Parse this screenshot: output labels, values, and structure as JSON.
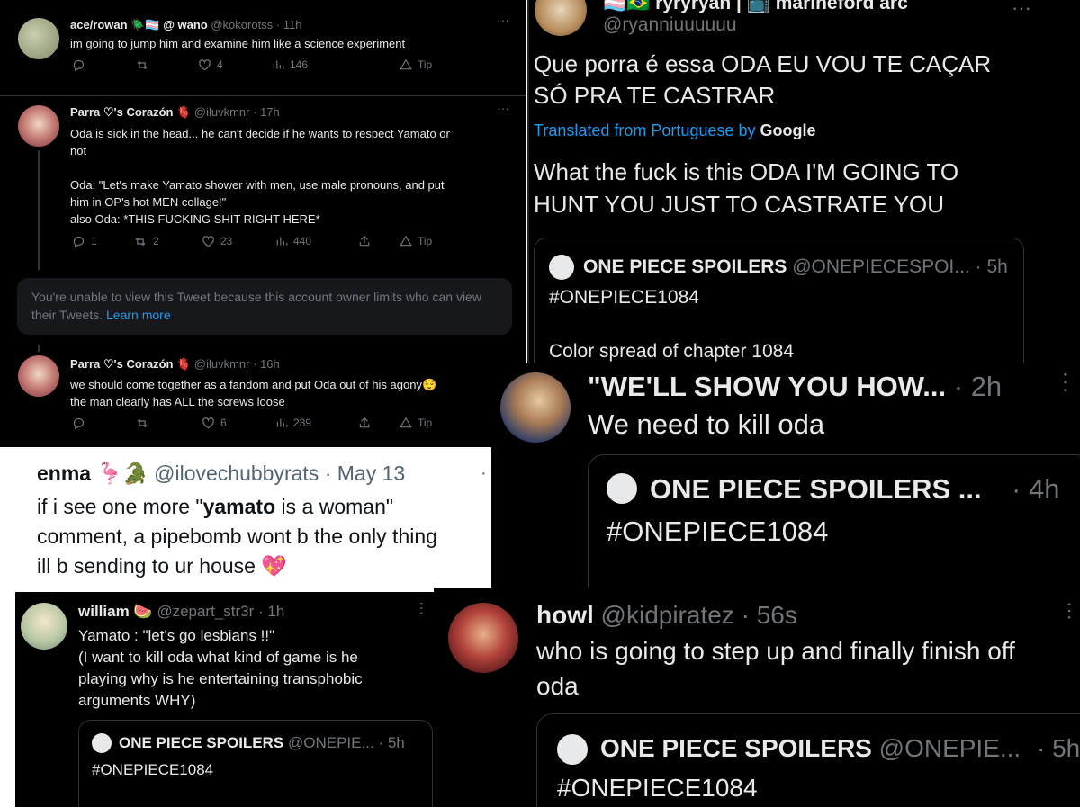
{
  "common": {
    "more": "···",
    "tip": "Tip",
    "dot": "·"
  },
  "p1": {
    "t1": {
      "name": "ace/rowan",
      "emoji": "🪲🏳️‍⚧️",
      "at": "@ wano",
      "handle": "@kokorotss",
      "time": "11h",
      "text": "im going to jump him and examine him like a science experiment",
      "likes": "4",
      "views": "146"
    },
    "t2": {
      "name": "Parra ♡'s Corazón",
      "emoji": "🫀",
      "handle": "@iluvkmnr",
      "time": "17h",
      "l1": "Oda is sick in the head... he can't decide if he wants to respect Yamato or",
      "l2": "not",
      "l3": "Oda: \"Let's make Yamato shower with men, use male pronouns, and put",
      "l4": "him in OP's hot MEN collage!\"",
      "l5": "also Oda: *THIS FUCKING SHIT RIGHT HERE*",
      "replies": "1",
      "retweets": "2",
      "likes": "23",
      "views": "440"
    },
    "restricted": {
      "text": "You're unable to view this Tweet because this account owner limits who can view their Tweets.",
      "link": "Learn more"
    },
    "t3": {
      "name": "Parra ♡'s Corazón",
      "emoji": "🫀",
      "handle": "@iluvkmnr",
      "time": "16h",
      "l1": "we should come together as a fandom and put Oda out of his agony😌",
      "l2": "the man clearly has ALL the screws loose",
      "likes": "6",
      "views": "239"
    }
  },
  "p2": {
    "name": "🏳️‍⚧️🇧🇷 ryryryan | 📺 marineford arc",
    "handle": "@ryanniuuuuuu",
    "orig1": "Que porra é essa ODA EU VOU TE CAÇAR",
    "orig2": "SÓ PRA TE CASTRAR",
    "translated": "Translated from Portuguese by",
    "google": "Google",
    "tr1": "What the fuck is this ODA I'M GOING TO",
    "tr2": "HUNT YOU JUST TO CASTRATE YOU",
    "quote": {
      "name": "ONE PIECE SPOILERS",
      "handle": "@ONEPIECESPOI...",
      "time": "5h",
      "text": "#ONEPIECE1084",
      "text2": "Color spread of chapter 1084"
    }
  },
  "p3": {
    "name": "\"WE'LL SHOW YOU HOW...",
    "time": "2h",
    "text": "We need to kill oda",
    "quote": {
      "name": "ONE PIECE SPOILERS ...",
      "time": "4h",
      "text": "#ONEPIECE1084"
    }
  },
  "p4": {
    "name": "enma 🦩🐊",
    "handle": "@ilovechubbyrats",
    "time": "May 13",
    "l1a": "if i see one more \"",
    "l1b": "yamato",
    "l1c": " is a woman\"",
    "l2": "comment, a pipebomb wont b the only thing",
    "l3": "ill b sending to ur house 💖"
  },
  "p5": {
    "name": "william 🍉",
    "handle": "@zepart_str3r",
    "time": "1h",
    "l1": "Yamato : \"let's go lesbians !!\"",
    "l2": "(I want to kill oda what kind of game is he",
    "l3": "playing why is he entertaining transphobic",
    "l4": "arguments WHY)",
    "quote": {
      "name": "ONE PIECE SPOILERS",
      "handle": "@ONEPIE...",
      "time": "5h",
      "text": "#ONEPIECE1084"
    }
  },
  "p6": {
    "name": "howl",
    "handle": "@kidpiratez",
    "time": "56s",
    "l1": "who is going to step up and finally finish off",
    "l2": "oda",
    "quote": {
      "name": "ONE PIECE SPOILERS",
      "handle": "@ONEPIE...",
      "time": "5h",
      "text": "#ONEPIECE1084"
    }
  },
  "colors": {
    "bg": "#000000",
    "text": "#e7e9ea",
    "muted": "#71767b",
    "link": "#1d9bf0",
    "border": "#2f3336"
  }
}
